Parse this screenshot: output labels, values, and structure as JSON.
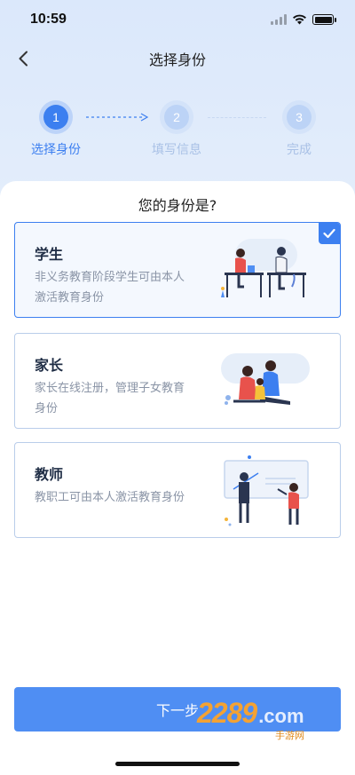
{
  "status_bar": {
    "time": "10:59"
  },
  "nav": {
    "title": "选择身份"
  },
  "stepper": {
    "steps": [
      {
        "number": "1",
        "label": "选择身份",
        "state": "active"
      },
      {
        "number": "2",
        "label": "填写信息",
        "state": "inactive"
      },
      {
        "number": "3",
        "label": "完成",
        "state": "inactive"
      }
    ]
  },
  "question": "您的身份是?",
  "cards": [
    {
      "title": "学生",
      "description": "非义务教育阶段学生可由本人激活教育身份",
      "selected": true,
      "illustration": "students-at-desk-illustration"
    },
    {
      "title": "家长",
      "description": "家长在线注册，管理子女教育身份",
      "selected": false,
      "illustration": "family-illustration"
    },
    {
      "title": "教师",
      "description": "教职工可由本人激活教育身份",
      "selected": false,
      "illustration": "teacher-whiteboard-illustration"
    }
  ],
  "next_button": {
    "label": "下一步"
  },
  "watermark": {
    "main": "2289",
    "suffix": ".com",
    "sub": "手游网"
  },
  "colors": {
    "accent": "#3c7ff0",
    "button": "#4f8ef3",
    "step_inactive": "#bcd3f6",
    "card_border": "#b9cdea"
  }
}
